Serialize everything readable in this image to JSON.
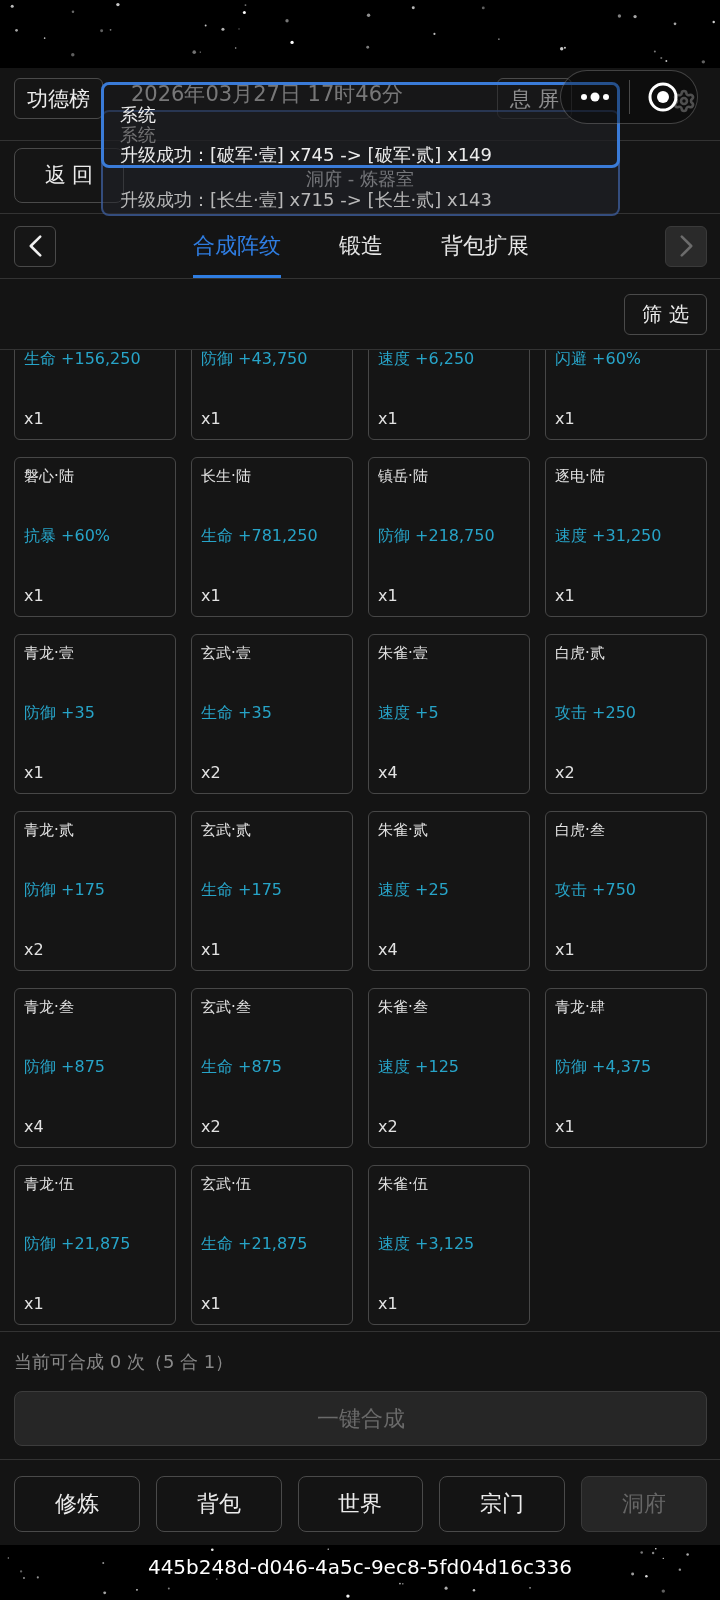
{
  "header": {
    "leaderboard_button": "功德榜",
    "datetime": "2026年03月27日 17时46分",
    "screen_off_button": "息 屏"
  },
  "nav_row": {
    "back_button": "返 回",
    "title": "洞府 - 炼器室"
  },
  "toasts": [
    {
      "title": "系统",
      "message": "升级成功：[破军·壹] x745 -> [破军·贰] x149",
      "fading": false
    },
    {
      "title": "系统",
      "message": "升级成功：[长生·壹] x715 -> [长生·贰] x143",
      "fading": true
    }
  ],
  "tab_arrows": [
    {
      "kind": "prev",
      "disabled": false
    },
    {
      "kind": "next",
      "disabled": true
    }
  ],
  "tabs": [
    {
      "label": "合成阵纹",
      "selected": true
    },
    {
      "label": "锻造",
      "selected": false
    },
    {
      "label": "背包扩展",
      "selected": false
    }
  ],
  "filter_button": "筛 选",
  "items": [
    {
      "stat": "生命 +156,250",
      "count": "x1"
    },
    {
      "stat": "防御 +43,750",
      "count": "x1"
    },
    {
      "stat": "速度 +6,250",
      "count": "x1"
    },
    {
      "stat": "闪避 +60%",
      "count": "x1"
    },
    {
      "name": "磐心·陆",
      "stat": "抗暴 +60%",
      "count": "x1"
    },
    {
      "name": "长生·陆",
      "stat": "生命 +781,250",
      "count": "x1"
    },
    {
      "name": "镇岳·陆",
      "stat": "防御 +218,750",
      "count": "x1"
    },
    {
      "name": "逐电·陆",
      "stat": "速度 +31,250",
      "count": "x1"
    },
    {
      "name": "青龙·壹",
      "stat": "防御 +35",
      "count": "x1"
    },
    {
      "name": "玄武·壹",
      "stat": "生命 +35",
      "count": "x2"
    },
    {
      "name": "朱雀·壹",
      "stat": "速度 +5",
      "count": "x4"
    },
    {
      "name": "白虎·贰",
      "stat": "攻击 +250",
      "count": "x2"
    },
    {
      "name": "青龙·贰",
      "stat": "防御 +175",
      "count": "x2"
    },
    {
      "name": "玄武·贰",
      "stat": "生命 +175",
      "count": "x1"
    },
    {
      "name": "朱雀·贰",
      "stat": "速度 +25",
      "count": "x4"
    },
    {
      "name": "白虎·叁",
      "stat": "攻击 +750",
      "count": "x1"
    },
    {
      "name": "青龙·叁",
      "stat": "防御 +875",
      "count": "x4"
    },
    {
      "name": "玄武·叁",
      "stat": "生命 +875",
      "count": "x2"
    },
    {
      "name": "朱雀·叁",
      "stat": "速度 +125",
      "count": "x2"
    },
    {
      "name": "青龙·肆",
      "stat": "防御 +4,375",
      "count": "x1"
    },
    {
      "name": "青龙·伍",
      "stat": "防御 +21,875",
      "count": "x1"
    },
    {
      "name": "玄武·伍",
      "stat": "生命 +21,875",
      "count": "x1"
    },
    {
      "name": "朱雀·伍",
      "stat": "速度 +3,125",
      "count": "x1"
    }
  ],
  "summary": "当前可合成 0 次（5 合 1）",
  "merge_button": {
    "label": "一键合成",
    "disabled": true
  },
  "bottom_nav": [
    {
      "label": "修炼",
      "selected": false
    },
    {
      "label": "背包",
      "selected": false
    },
    {
      "label": "世界",
      "selected": false
    },
    {
      "label": "宗门",
      "selected": false
    },
    {
      "label": "洞府",
      "selected": true
    }
  ],
  "device_id": "445b248d-d046-4a5c-9ec8-5fd04d16c336"
}
